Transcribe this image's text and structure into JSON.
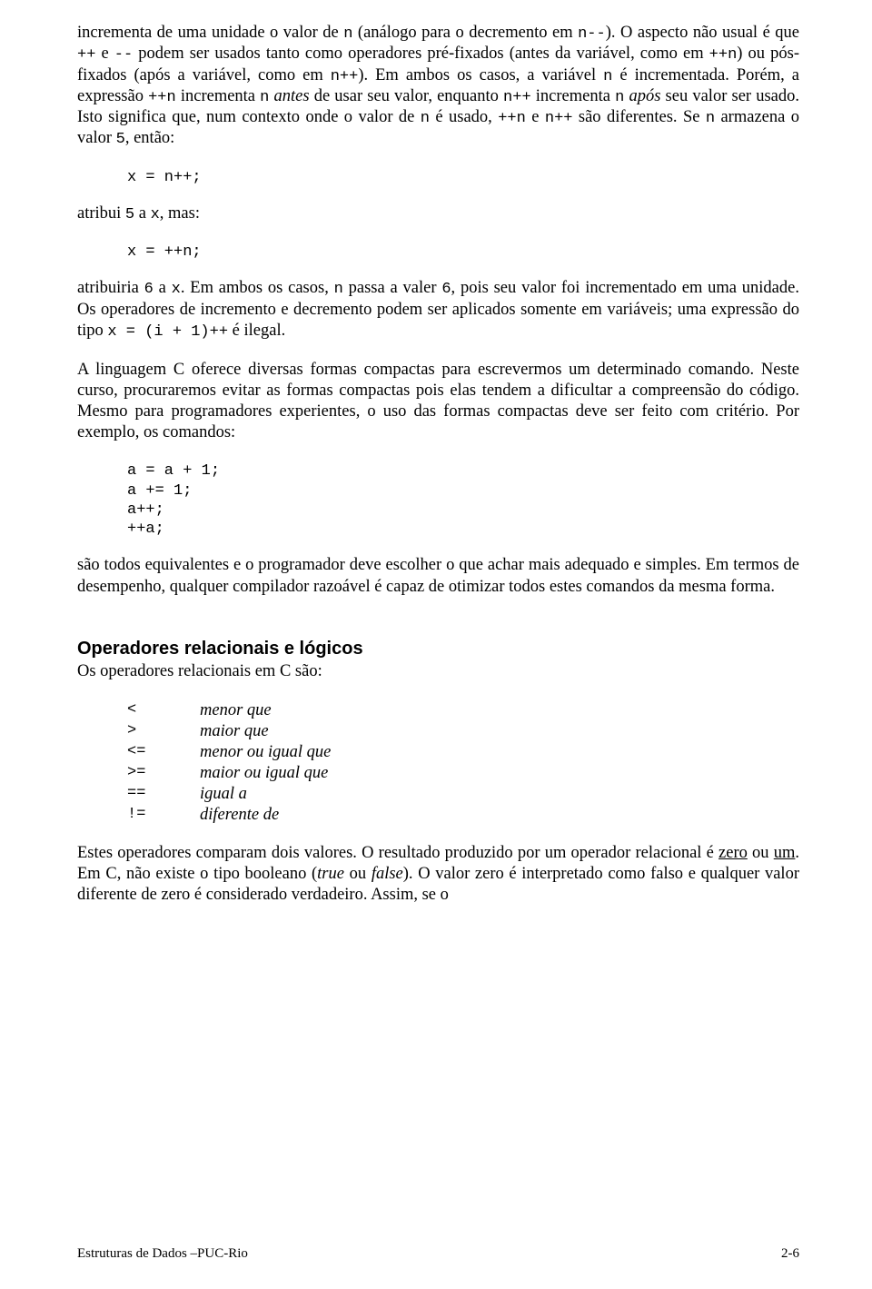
{
  "para1": {
    "s1a": "incrementa de uma unidade o valor de ",
    "s1b": "n",
    "s1c": " (análogo para o decremento em ",
    "s1d": "n--",
    "s1e": "). O aspecto não usual é que ",
    "s1f": "++",
    "s1g": " e ",
    "s1h": "--",
    "s1i": " podem ser usados tanto como operadores pré-fixados (antes da variável, como em ",
    "s1j": "++n",
    "s1k": ") ou pós-fixados (após a variável, como em ",
    "s1l": "n++",
    "s1m": "). Em ambos os casos, a variável ",
    "s1n": "n",
    "s1o": " é incrementada. Porém, a expressão ",
    "s1p": "++n",
    "s1q": " incrementa ",
    "s1r": "n",
    "s1s": " antes",
    "s1t": " de usar seu valor, enquanto ",
    "s1u": "n++",
    "s1v": " incrementa ",
    "s1w": "n",
    "s1x": " após",
    "s1y": " seu valor ser usado. Isto significa que, num contexto onde o valor de ",
    "s1z": "n",
    "s1aa": " é usado, ",
    "s1ab": "++n",
    "s1ac": " e ",
    "s1ad": "n++",
    "s1ae": " são diferentes. Se ",
    "s1af": "n",
    "s1ag": " armazena o valor ",
    "s1ah": "5",
    "s1ai": ", então:"
  },
  "code1": "x = n++;",
  "para2": {
    "a": "atribui ",
    "b": "5",
    "c": " a ",
    "d": "x",
    "e": ", mas:"
  },
  "code2": "x = ++n;",
  "para3": {
    "a": "atribuiria ",
    "b": "6",
    "c": " a ",
    "d": "x",
    "e": ". Em ambos os casos, ",
    "f": "n",
    "g": " passa a valer ",
    "h": "6",
    "i": ", pois seu valor foi incrementado em uma unidade. Os operadores de incremento e decremento podem ser aplicados somente em variáveis; uma expressão do tipo ",
    "j": "x = (i + 1)++",
    "k": " é ilegal."
  },
  "para4": "A linguagem C oferece diversas formas compactas para escrevermos um determinado comando. Neste curso, procuraremos evitar as formas compactas pois elas tendem a dificultar a compreensão do código. Mesmo para programadores experientes, o uso das formas compactas deve ser feito com critério. Por exemplo, os comandos:",
  "code3": "a = a + 1;\na += 1;\na++;\n++a;",
  "para5": "são todos equivalentes e o programador deve escolher o que achar mais adequado e simples. Em termos de desempenho, qualquer compilador razoável é capaz de otimizar todos estes comandos da mesma forma.",
  "heading1": "Operadores relacionais e lógicos",
  "para6": "Os operadores relacionais em C são:",
  "ops": [
    {
      "sym": "<",
      "desc": "menor que"
    },
    {
      "sym": ">",
      "desc": "maior que"
    },
    {
      "sym": "<=",
      "desc": "menor ou igual que"
    },
    {
      "sym": ">=",
      "desc": "maior ou igual que"
    },
    {
      "sym": "==",
      "desc": "igual a"
    },
    {
      "sym": "!=",
      "desc": "diferente de"
    }
  ],
  "para7": {
    "a": "Estes operadores comparam dois valores. O resultado produzido por um operador relacional é ",
    "b": "zero",
    "c": " ou ",
    "d": "um",
    "e": ". Em C, não existe o tipo booleano (",
    "f": "true",
    "g": " ou ",
    "h": "false",
    "i": "). O valor zero é interpretado como falso e qualquer valor diferente de zero é considerado verdadeiro. Assim, se o"
  },
  "footer": {
    "left": "Estruturas de Dados –PUC-Rio",
    "right": "2-6"
  }
}
